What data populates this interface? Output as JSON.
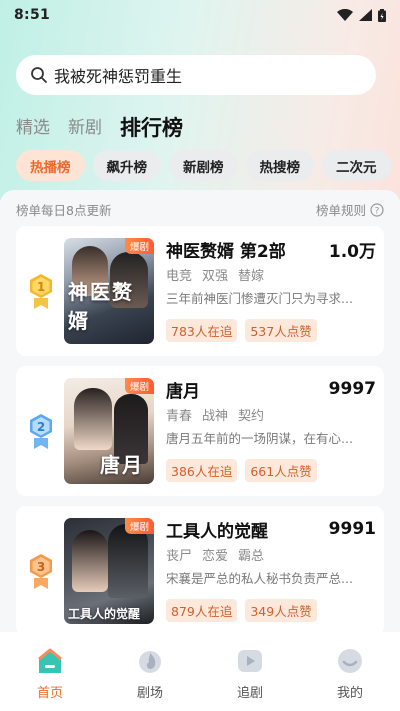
{
  "status_bar": {
    "time": "8:51"
  },
  "search": {
    "value": "我被死神惩罚重生"
  },
  "main_tabs": [
    {
      "label": "精选"
    },
    {
      "label": "新剧"
    },
    {
      "label": "排行榜"
    }
  ],
  "sub_tabs": [
    {
      "label": "热播榜"
    },
    {
      "label": "飙升榜"
    },
    {
      "label": "新剧榜"
    },
    {
      "label": "热搜榜"
    },
    {
      "label": "二次元"
    }
  ],
  "list_header": {
    "update_note": "榜单每日8点更新",
    "rules_label": "榜单规则"
  },
  "dramas": [
    {
      "rank": "1",
      "title": "神医赘婿 第2部",
      "score": "1.0万",
      "poster_tag": "爆剧",
      "poster_text": "神医赘婿",
      "tags": [
        "电竞",
        "双强",
        "替嫁"
      ],
      "desc": "三年前神医门惨遭灭门只为寻求...",
      "followers": "783人在追",
      "likes": "537人点赞",
      "badge_color": "#f5b82a"
    },
    {
      "rank": "2",
      "title": "唐月",
      "score": "9997",
      "poster_tag": "爆剧",
      "poster_text": "唐月",
      "tags": [
        "青春",
        "战神",
        "契约"
      ],
      "desc": "唐月五年前的一场阴谋，在有心...",
      "followers": "386人在追",
      "likes": "661人点赞",
      "badge_color": "#5aa8f0"
    },
    {
      "rank": "3",
      "title": "工具人的觉醒",
      "score": "9991",
      "poster_tag": "爆剧",
      "poster_text": "工具人的觉醒",
      "tags": [
        "丧尸",
        "恋爱",
        "霸总"
      ],
      "desc": "宋襄是严总的私人秘书负责严总...",
      "followers": "879人在追",
      "likes": "349人点赞",
      "badge_color": "#f59a4a"
    }
  ],
  "bottom_nav": [
    {
      "label": "首页",
      "icon": "home-icon"
    },
    {
      "label": "剧场",
      "icon": "theater-icon"
    },
    {
      "label": "追剧",
      "icon": "play-icon"
    },
    {
      "label": "我的",
      "icon": "profile-icon"
    }
  ],
  "colors": {
    "accent": "#ee6a2c",
    "accent_bg": "#fde4d5"
  }
}
